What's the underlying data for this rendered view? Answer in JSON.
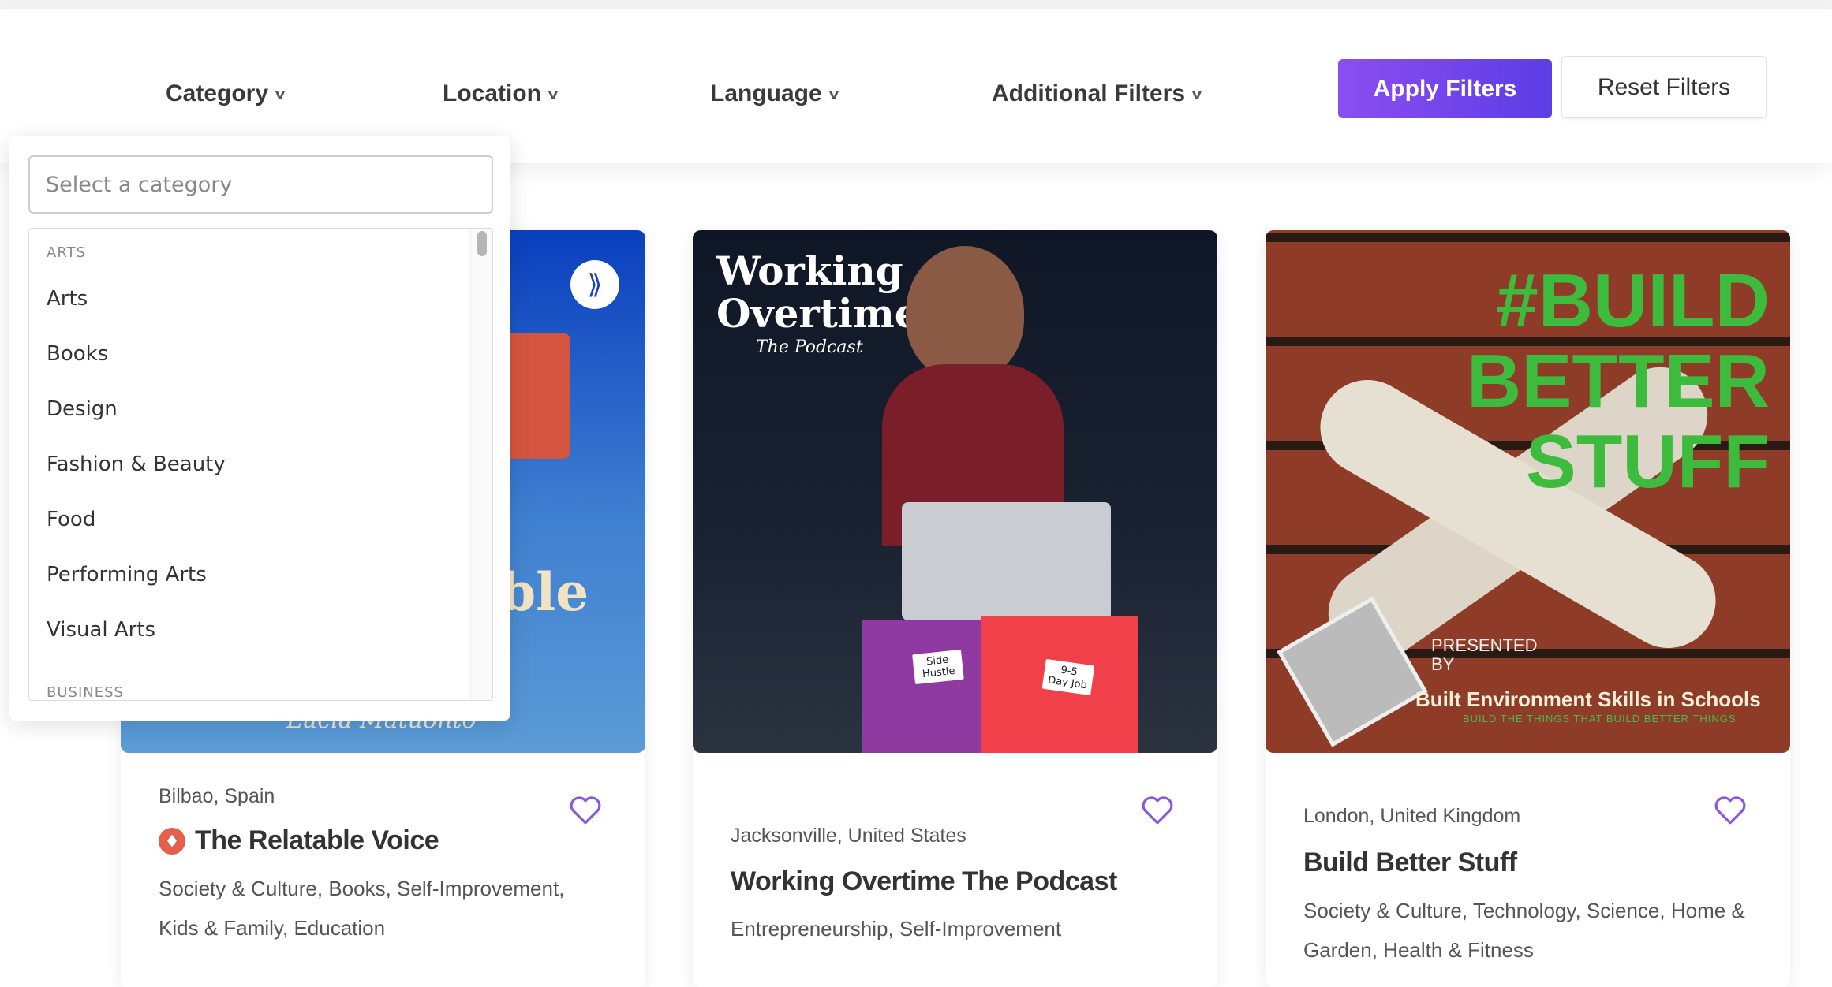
{
  "filters": {
    "category": "Category",
    "location": "Location",
    "language": "Language",
    "additional": "Additional Filters",
    "apply": "Apply Filters",
    "reset": "Reset Filters"
  },
  "dropdown": {
    "placeholder": "Select a category",
    "groups": [
      {
        "label": "ARTS",
        "items": [
          "Arts",
          "Books",
          "Design",
          "Fashion & Beauty",
          "Food",
          "Performing Arts",
          "Visual Arts"
        ]
      },
      {
        "label": "BUSINESS"
      }
    ]
  },
  "cards": [
    {
      "location": "Bilbao, Spain",
      "title": "The Relatable Voice",
      "description": "Society & Culture, Books, Self-Improvement, Kids & Family, Education",
      "art": {
        "partial_word": "ble",
        "author": "Lucia Matuonto"
      }
    },
    {
      "location": "Jacksonville, United States",
      "title": "Working Overtime The Podcast",
      "description": "Entrepreneurship, Self-Improvement",
      "art": {
        "line1": "Working",
        "line2": "Overtime",
        "subtitle": "The Podcast",
        "folder1": "Side Hustle",
        "folder2": "9-5 Day Job"
      }
    },
    {
      "location": "London, United Kingdom",
      "title": "Build Better Stuff",
      "description": "Society & Culture, Technology, Science, Home & Garden, Health & Fitness",
      "art": {
        "line1": "#BUILD",
        "line2": "BETTER",
        "line3": "STUFF",
        "presented": "PRESENTED BY",
        "org": "Built Environment Skills in Schools",
        "tagline": "BUILD THE THINGS THAT BUILD BETTER THINGS"
      }
    }
  ],
  "colors": {
    "accent": "#7a4ae8",
    "heart": "#8a55e0",
    "badge": "#e4604a"
  }
}
